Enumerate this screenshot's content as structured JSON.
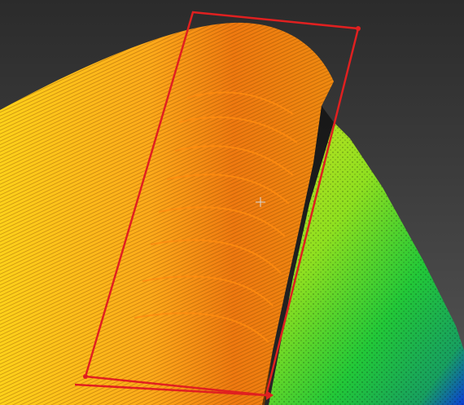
{
  "viewer": {
    "background_colors": [
      "#2b2b2b",
      "#555555"
    ],
    "colormap": [
      "#ffd21a",
      "#ff9a1a",
      "#f07a10",
      "#8fe020",
      "#22c838",
      "#0a3fd8"
    ]
  },
  "selection": {
    "stroke_color": "#e02020",
    "shape": "polygon",
    "handles": 3
  },
  "cursor": {
    "type": "crosshair"
  }
}
